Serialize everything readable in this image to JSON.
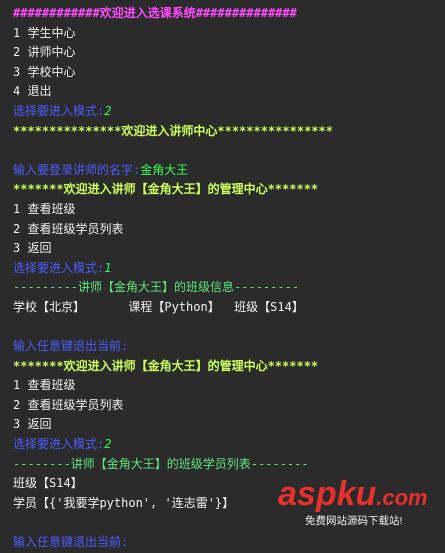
{
  "lines": [
    {
      "text": "############欢迎进入选课系统##############",
      "color": "#ff4bff"
    },
    {
      "text": "1 学生中心",
      "color": "#f2f2f2"
    },
    {
      "text": "2 讲师中心",
      "color": "#f2f2f2"
    },
    {
      "text": "3 学校中心",
      "color": "#f2f2f2"
    },
    {
      "text": "4 退出",
      "color": "#f2f2f2"
    },
    {
      "prompt": "选择要进入模式:",
      "value": "2"
    },
    {
      "text": "***************欢迎进入讲师中心****************",
      "color": "#c8ff5a"
    },
    {
      "blank": true
    },
    {
      "prompt": "输入要登录讲师的名字:",
      "value": "金角大王"
    },
    {
      "text": "*******欢迎进入讲师【金角大王】的管理中心*******",
      "color": "#c8ff5a"
    },
    {
      "text": "1 查看班级",
      "color": "#f2f2f2"
    },
    {
      "text": "2 查看班级学员列表",
      "color": "#f2f2f2"
    },
    {
      "text": "3 返回",
      "color": "#f2f2f2"
    },
    {
      "prompt": "选择要进入模式:",
      "value": "1"
    },
    {
      "text": "---------讲师【金角大王】的班级信息---------",
      "color": "#5fe77a"
    },
    {
      "text": "学校【北京】      课程【Python】  班级【S14】",
      "color": "#f2f2f2"
    },
    {
      "blank": true
    },
    {
      "prompt": "输入任意键退出当前:",
      "value": ""
    },
    {
      "text": "*******欢迎进入讲师【金角大王】的管理中心*******",
      "color": "#c8ff5a"
    },
    {
      "text": "1 查看班级",
      "color": "#f2f2f2"
    },
    {
      "text": "2 查看班级学员列表",
      "color": "#f2f2f2"
    },
    {
      "text": "3 返回",
      "color": "#f2f2f2"
    },
    {
      "prompt": "选择要进入模式:",
      "value": "2"
    },
    {
      "text": "--------讲师【金角大王】的班级学员列表--------",
      "color": "#5fe77a"
    },
    {
      "text": "班级【S14】",
      "color": "#f2f2f2"
    },
    {
      "text": "学员【{'我要学python', '连志雷'}】",
      "color": "#f2f2f2"
    },
    {
      "blank": true
    },
    {
      "prompt": "输入任意键退出当前:",
      "value": ""
    }
  ],
  "colors": {
    "prompt": "#4c5cff",
    "input_value": "#2fff53"
  },
  "watermark": {
    "logo": "aspku",
    "tld": ".com",
    "subtitle": "免费网站源码下载站!"
  }
}
